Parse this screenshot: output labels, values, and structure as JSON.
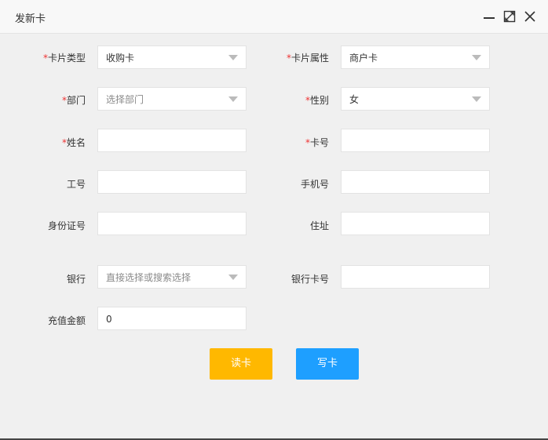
{
  "window": {
    "title": "发新卡"
  },
  "form": {
    "card_type": {
      "label": "卡片类型",
      "value": "收购卡"
    },
    "card_attr": {
      "label": "卡片属性",
      "value": "商户卡"
    },
    "department": {
      "label": "部门",
      "placeholder": "选择部门"
    },
    "gender": {
      "label": "性别",
      "value": "女"
    },
    "name": {
      "label": "姓名",
      "value": ""
    },
    "card_no": {
      "label": "卡号",
      "value": ""
    },
    "employee_id": {
      "label": "工号",
      "value": ""
    },
    "phone": {
      "label": "手机号",
      "value": ""
    },
    "id_no": {
      "label": "身份证号",
      "value": ""
    },
    "address": {
      "label": "住址",
      "value": ""
    },
    "bank": {
      "label": "银行",
      "placeholder": "直接选择或搜索选择"
    },
    "bank_card_no": {
      "label": "银行卡号",
      "value": ""
    },
    "recharge": {
      "label": "充值金额",
      "value": "0"
    }
  },
  "actions": {
    "read_card": "读卡",
    "write_card": "写卡"
  },
  "colors": {
    "read_button": "#ffb800",
    "write_button": "#1e9fff",
    "required_mark": "#ee3333"
  },
  "required_mark": "*"
}
